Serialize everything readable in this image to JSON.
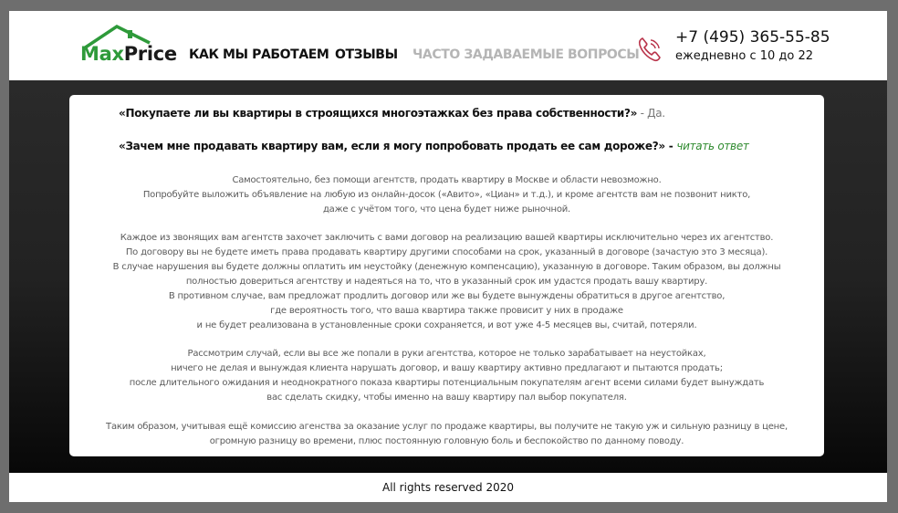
{
  "brand": {
    "max": "Max",
    "price": "Price",
    "green": "#2e9a3a",
    "dark": "#1a1a1a"
  },
  "nav": {
    "how": "КАК МЫ РАБОТАЕМ",
    "reviews": "ОТЗЫВЫ",
    "faq": "ЧАСТО ЗАДАВАЕМЫЕ ВОПРОСЫ"
  },
  "contact": {
    "phone": "+7 (495) 365-55-85",
    "hours": "ежедневно с 10 до 22",
    "icon": "phone-icon",
    "icon_color": "#b9334a"
  },
  "faq": {
    "q1": {
      "question": "«Покупаете ли вы квартиры в строящихся многоэтажках без права собственности?»",
      "answer": " - Да."
    },
    "q2": {
      "question": "«Зачем мне продавать квартиру вам, если я могу попробовать продать ее сам дороже?» - ",
      "link": "читать ответ"
    }
  },
  "answer": {
    "p1": [
      "Самостоятельно, без помощи агентств, продать квартиру в Москве и области невозможно.",
      "Попробуйте выложить объявление на любую из онлайн-досок («Авито», «Циан» и т.д.), и кроме агентств вам не позвонит никто,",
      "даже с учётом того, что цена будет ниже рыночной."
    ],
    "p2": [
      "Каждое из звонящих вам агентств захочет заключить с вами договор на реализацию вашей квартиры исключительно через их агентство.",
      "По договору вы не будете иметь права продавать квартиру другими способами на срок, указанный в договоре (зачастую это 3 месяца).",
      "В случае нарушения вы будете должны оплатить им неустойку (денежную компенсацию), указанную в договоре. Таким образом, вы должны",
      "полностью довериться агентству и надеяться на то, что в указанный срок им удастся продать вашу квартиру.",
      "В противном случае, вам предложат  продлить договор или же вы будете вынуждены обратиться в другое агентство,",
      "где вероятность того, что ваша квартира также провисит у них в продаже",
      "и не будет реализована в установленные сроки сохраняется, и вот уже 4-5 месяцев вы, считай, потеряли."
    ],
    "p3": [
      "Рассмотрим случай, если вы все же попали в руки агентства, которое не только зарабатывает на неустойках,",
      "ничего не делая и вынуждая клиента нарушать договор, и вашу квартиру активно предлагают и пытаются продать;",
      "после длительного ожидания и неоднократного показа квартиры потенциальным покупателям агент всеми силами будет вынуждать",
      "вас сделать скидку, чтобы именно на вашу квартиру пал выбор покупателя."
    ],
    "p4": [
      "Таким образом, учитывая ещё комиссию агенства за оказание услуг по продаже квартиры, вы получите не такую уж и сильную разницу в цене,",
      "огромную разницу во времени, плюс постоянную головную боль и беспокойство по данному поводу."
    ]
  },
  "footer": {
    "text": "All rights reserved 2020"
  }
}
